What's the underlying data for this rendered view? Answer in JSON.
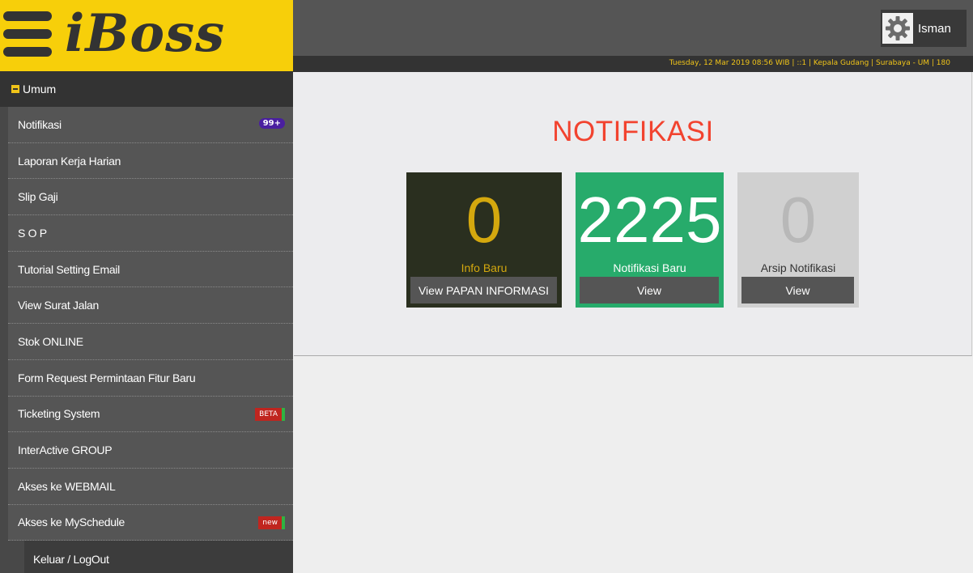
{
  "brand": {
    "name": "iBoss",
    "logo_color": "#f7cf0a"
  },
  "user": {
    "name": "Isman",
    "icon": "gear-icon"
  },
  "infobar": {
    "text": "Tuesday, 12 Mar 2019 08:56 WIB | ::1 | Kepala Gudang | Surabaya - UM | 180"
  },
  "sidebar": {
    "group_label": "Umum",
    "items": [
      {
        "label": "Notifikasi",
        "badge": "99+"
      },
      {
        "label": "Laporan Kerja Harian"
      },
      {
        "label": "Slip Gaji"
      },
      {
        "label": "S O P"
      },
      {
        "label": "Tutorial Setting Email"
      },
      {
        "label": "View Surat Jalan"
      },
      {
        "label": "Stok ONLINE"
      },
      {
        "label": "Form Request Permintaan Fitur Baru"
      },
      {
        "label": "Ticketing System",
        "tag": "BETA"
      },
      {
        "label": "InterActive GROUP"
      },
      {
        "label": "Akses ke WEBMAIL"
      },
      {
        "label": "Akses ke MySchedule",
        "tag": "new"
      },
      {
        "label": "Keluar / LogOut"
      }
    ]
  },
  "main": {
    "title": "NOTIFIKASI",
    "cards": [
      {
        "value": "0",
        "caption": "Info Baru",
        "button": "View PAPAN INFORMASI",
        "color": "#2a2f1f"
      },
      {
        "value": "2225",
        "caption": "Notifikasi Baru",
        "button": "View",
        "color": "#27ab6b"
      },
      {
        "value": "0",
        "caption": "Arsip Notifikasi",
        "button": "View",
        "color": "#d0d0d0"
      }
    ]
  }
}
